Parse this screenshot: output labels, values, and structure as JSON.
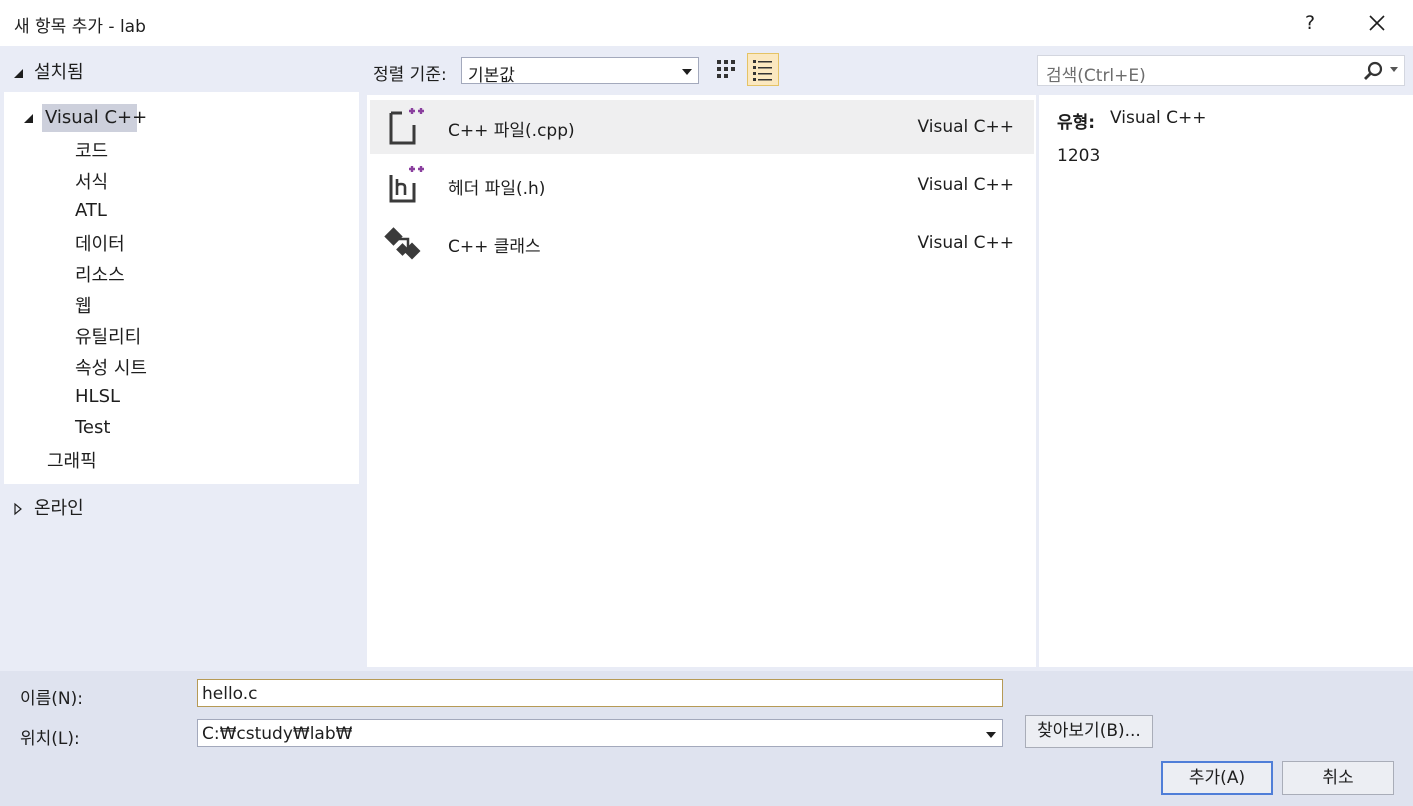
{
  "window": {
    "title": "새 항목 추가 - lab",
    "help_label": "?"
  },
  "left": {
    "installed_label": "설치됨",
    "tree": {
      "root_label": "Visual C++",
      "children": [
        "코드",
        "서식",
        "ATL",
        "데이터",
        "리소스",
        "웹",
        "유틸리티",
        "속성 시트",
        "HLSL",
        "Test"
      ],
      "sibling_label": "그래픽"
    },
    "online_label": "온라인"
  },
  "toolbar": {
    "sort_label": "정렬 기준:",
    "sort_value": "기본값"
  },
  "search": {
    "placeholder": "검색(Ctrl+E)"
  },
  "items": [
    {
      "name": "C++ 파일(.cpp)",
      "lang": "Visual C++",
      "icon": "cpp-file-icon",
      "selected": true
    },
    {
      "name": "헤더 파일(.h)",
      "lang": "Visual C++",
      "icon": "header-file-icon",
      "selected": false
    },
    {
      "name": "C++ 클래스",
      "lang": "Visual C++",
      "icon": "cpp-class-icon",
      "selected": false
    }
  ],
  "details": {
    "type_label": "유형:",
    "type_value": "Visual C++",
    "description": "1203"
  },
  "form": {
    "name_label": "이름(N):",
    "name_value": "hello.c",
    "location_label": "위치(L):",
    "location_value": "C:₩cstudy₩lab₩",
    "browse_label": "찾아보기(B)...",
    "add_label": "추가(A)",
    "cancel_label": "취소"
  },
  "colors": {
    "accent_purple": "#8a3f9e",
    "selection": "#cdd0dc",
    "default_button_border": "#4f7ed8"
  }
}
